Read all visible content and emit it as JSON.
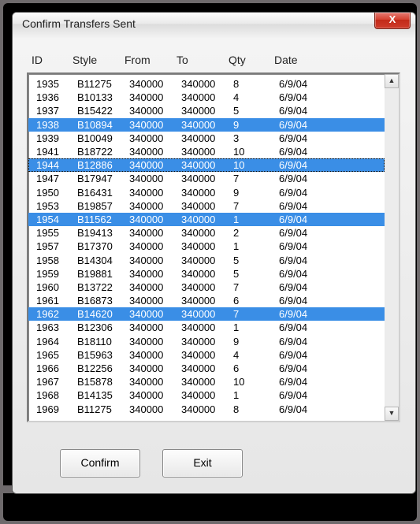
{
  "window": {
    "title": "Confirm Transfers Sent",
    "close_icon": "X"
  },
  "headers": {
    "id": "ID",
    "style": "Style",
    "from": "From",
    "to": "To",
    "qty": "Qty",
    "date": "Date"
  },
  "rows": [
    {
      "id": "1935",
      "style": "B11275",
      "from": "340000",
      "to": "340000",
      "qty": "8",
      "date": "6/9/04",
      "selected": false,
      "focused": false
    },
    {
      "id": "1936",
      "style": "B10133",
      "from": "340000",
      "to": "340000",
      "qty": "4",
      "date": "6/9/04",
      "selected": false,
      "focused": false
    },
    {
      "id": "1937",
      "style": "B15422",
      "from": "340000",
      "to": "340000",
      "qty": "5",
      "date": "6/9/04",
      "selected": false,
      "focused": false
    },
    {
      "id": "1938",
      "style": "B10894",
      "from": "340000",
      "to": "340000",
      "qty": "9",
      "date": "6/9/04",
      "selected": true,
      "focused": false
    },
    {
      "id": "1939",
      "style": "B10049",
      "from": "340000",
      "to": "340000",
      "qty": "3",
      "date": "6/9/04",
      "selected": false,
      "focused": false
    },
    {
      "id": "1941",
      "style": "B18722",
      "from": "340000",
      "to": "340000",
      "qty": "10",
      "date": "6/9/04",
      "selected": false,
      "focused": false
    },
    {
      "id": "1944",
      "style": "B12886",
      "from": "340000",
      "to": "340000",
      "qty": "10",
      "date": "6/9/04",
      "selected": true,
      "focused": true
    },
    {
      "id": "1947",
      "style": "B17947",
      "from": "340000",
      "to": "340000",
      "qty": "7",
      "date": "6/9/04",
      "selected": false,
      "focused": false
    },
    {
      "id": "1950",
      "style": "B16431",
      "from": "340000",
      "to": "340000",
      "qty": "9",
      "date": "6/9/04",
      "selected": false,
      "focused": false
    },
    {
      "id": "1953",
      "style": "B19857",
      "from": "340000",
      "to": "340000",
      "qty": "7",
      "date": "6/9/04",
      "selected": false,
      "focused": false
    },
    {
      "id": "1954",
      "style": "B11562",
      "from": "340000",
      "to": "340000",
      "qty": "1",
      "date": "6/9/04",
      "selected": true,
      "focused": false
    },
    {
      "id": "1955",
      "style": "B19413",
      "from": "340000",
      "to": "340000",
      "qty": "2",
      "date": "6/9/04",
      "selected": false,
      "focused": false
    },
    {
      "id": "1957",
      "style": "B17370",
      "from": "340000",
      "to": "340000",
      "qty": "1",
      "date": "6/9/04",
      "selected": false,
      "focused": false
    },
    {
      "id": "1958",
      "style": "B14304",
      "from": "340000",
      "to": "340000",
      "qty": "5",
      "date": "6/9/04",
      "selected": false,
      "focused": false
    },
    {
      "id": "1959",
      "style": "B19881",
      "from": "340000",
      "to": "340000",
      "qty": "5",
      "date": "6/9/04",
      "selected": false,
      "focused": false
    },
    {
      "id": "1960",
      "style": "B13722",
      "from": "340000",
      "to": "340000",
      "qty": "7",
      "date": "6/9/04",
      "selected": false,
      "focused": false
    },
    {
      "id": "1961",
      "style": "B16873",
      "from": "340000",
      "to": "340000",
      "qty": "6",
      "date": "6/9/04",
      "selected": false,
      "focused": false
    },
    {
      "id": "1962",
      "style": "B14620",
      "from": "340000",
      "to": "340000",
      "qty": "7",
      "date": "6/9/04",
      "selected": true,
      "focused": false
    },
    {
      "id": "1963",
      "style": "B12306",
      "from": "340000",
      "to": "340000",
      "qty": "1",
      "date": "6/9/04",
      "selected": false,
      "focused": false
    },
    {
      "id": "1964",
      "style": "B18110",
      "from": "340000",
      "to": "340000",
      "qty": "9",
      "date": "6/9/04",
      "selected": false,
      "focused": false
    },
    {
      "id": "1965",
      "style": "B15963",
      "from": "340000",
      "to": "340000",
      "qty": "4",
      "date": "6/9/04",
      "selected": false,
      "focused": false
    },
    {
      "id": "1966",
      "style": "B12256",
      "from": "340000",
      "to": "340000",
      "qty": "6",
      "date": "6/9/04",
      "selected": false,
      "focused": false
    },
    {
      "id": "1967",
      "style": "B15878",
      "from": "340000",
      "to": "340000",
      "qty": "10",
      "date": "6/9/04",
      "selected": false,
      "focused": false
    },
    {
      "id": "1968",
      "style": "B14135",
      "from": "340000",
      "to": "340000",
      "qty": "1",
      "date": "6/9/04",
      "selected": false,
      "focused": false
    },
    {
      "id": "1969",
      "style": "B11275",
      "from": "340000",
      "to": "340000",
      "qty": "8",
      "date": "6/9/04",
      "selected": false,
      "focused": false
    }
  ],
  "scroll": {
    "up_glyph": "▲",
    "down_glyph": "▼"
  },
  "buttons": {
    "confirm": "Confirm",
    "exit": "Exit"
  }
}
